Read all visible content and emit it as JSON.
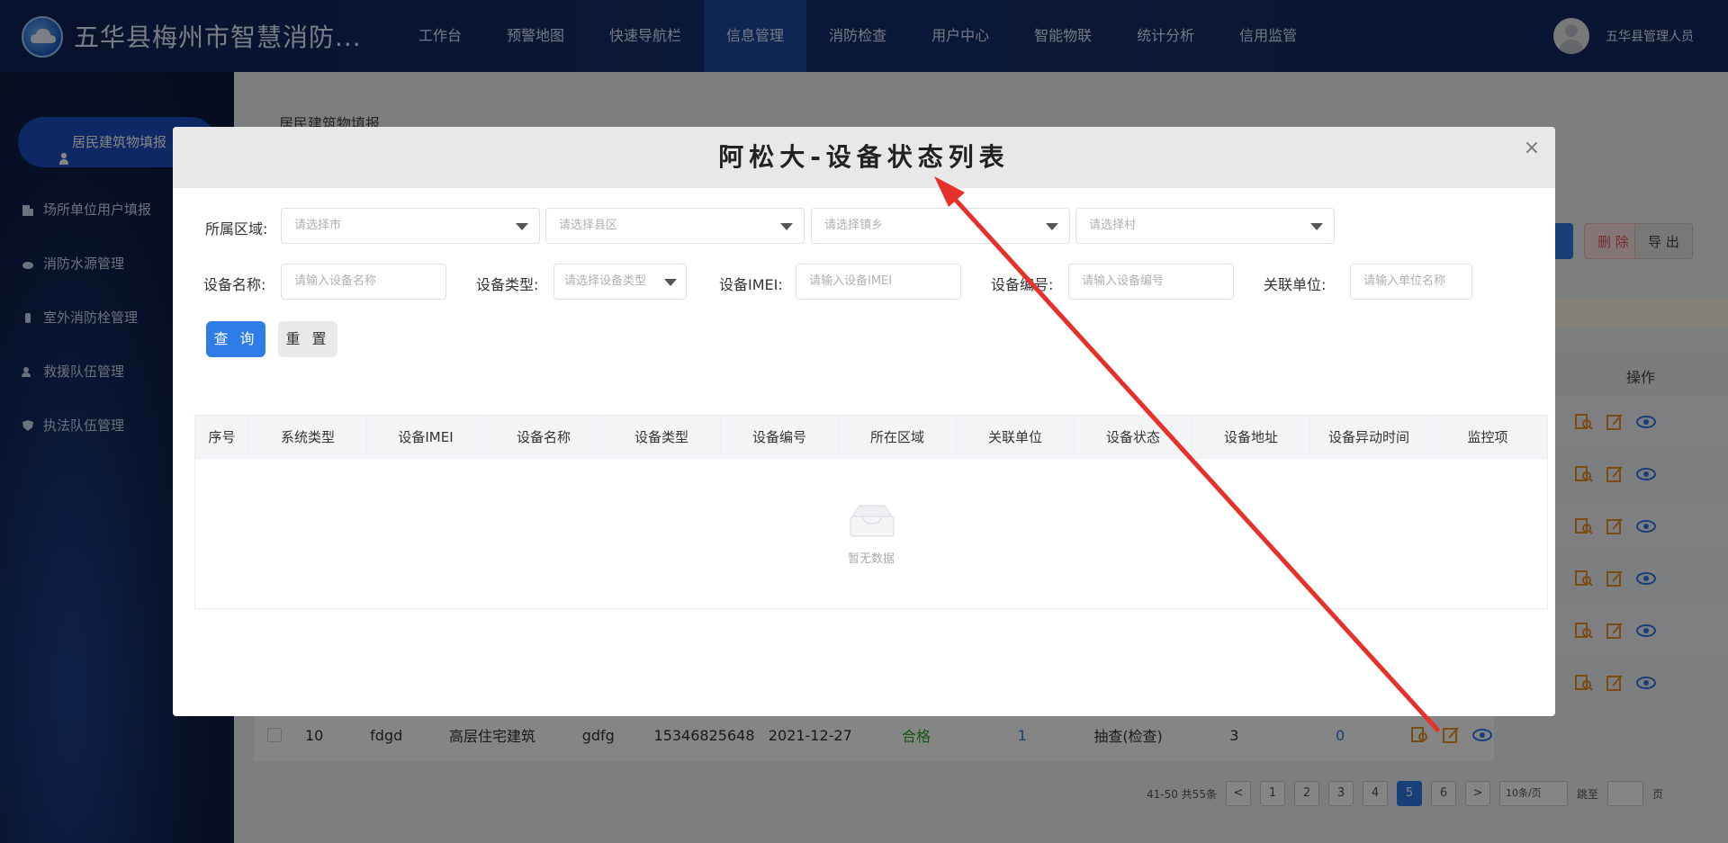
{
  "header": {
    "app_title": "五华县梅州市智慧消防...",
    "nav": [
      "工作台",
      "预警地图",
      "快速导航栏",
      "信息管理",
      "消防检查",
      "用户中心",
      "智能物联",
      "统计分析",
      "信用监管"
    ],
    "active_nav": "信息管理",
    "user_name": "五华县管理人员"
  },
  "sidebar": {
    "active": "居民建筑物填报",
    "items": [
      "场所单位用户填报",
      "消防水源管理",
      "室外消防栓管理",
      "救援队伍管理",
      "执法队伍管理"
    ]
  },
  "background_page": {
    "breadcrumb": "居民建筑物填报",
    "delete_label": "删 除",
    "export_label": "导 出",
    "op_header": "操作",
    "last_row": {
      "index": "10",
      "name": "fdgd",
      "type": "高层住宅建筑",
      "c4": "gdfg",
      "phone": "15346825648",
      "date": "2021-12-27",
      "result": "合格",
      "n1": "1",
      "method": "抽查(检查)",
      "n2": "3",
      "n3": "0"
    },
    "pagination": {
      "summary": "41-50 共55条",
      "pages": [
        "1",
        "2",
        "3",
        "4",
        "5",
        "6"
      ],
      "current": "5",
      "page_size": "10条/页",
      "jump_label": "跳至",
      "page_suffix": "页"
    }
  },
  "modal": {
    "title": "阿松大-设备状态列表",
    "filters": {
      "region_label": "所属区域:",
      "city_placeholder": "请选择市",
      "county_placeholder": "请选择县区",
      "town_placeholder": "请选择镇乡",
      "village_placeholder": "请选择村",
      "device_name_label": "设备名称:",
      "device_name_placeholder": "请输入设备名称",
      "device_type_label": "设备类型:",
      "device_type_placeholder": "请选择设备类型",
      "imei_label": "设备IMEI:",
      "imei_placeholder": "请输入设备IMEI",
      "device_no_label": "设备编号:",
      "device_no_placeholder": "请输入设备编号",
      "unit_label": "关联单位:",
      "unit_placeholder": "请输入单位名称"
    },
    "query_label": "查 询",
    "reset_label": "重 置",
    "columns": [
      "序号",
      "系统类型",
      "设备IMEI",
      "设备名称",
      "设备类型",
      "设备编号",
      "所在区域",
      "关联单位",
      "设备状态",
      "设备地址",
      "设备异动时间",
      "监控项"
    ],
    "empty_text": "暂无数据"
  },
  "colors": {
    "primary": "#2d7ce8",
    "header_bg": "#12295f",
    "arrow": "#e8302a",
    "success": "#2aa52a"
  }
}
